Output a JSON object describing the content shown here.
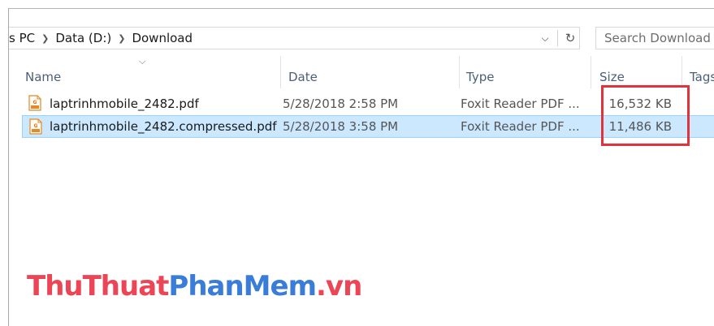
{
  "breadcrumb": {
    "items": [
      "s PC",
      "Data (D:)",
      "Download"
    ]
  },
  "search": {
    "placeholder": "Search Download"
  },
  "columns": {
    "name": "Name",
    "date": "Date",
    "type": "Type",
    "size": "Size",
    "tags": "Tags"
  },
  "files": [
    {
      "name": "laptrinhmobile_2482.pdf",
      "date": "5/28/2018 2:58 PM",
      "type": "Foxit Reader PDF ...",
      "size": "16,532 KB",
      "selected": false
    },
    {
      "name": "laptrinhmobile_2482.compressed.pdf",
      "date": "5/28/2018 3:58 PM",
      "type": "Foxit Reader PDF ...",
      "size": "11,486 KB",
      "selected": true
    }
  ],
  "watermark": {
    "part1": "ThuThuat",
    "part2": "PhanMem",
    "part3": ".vn"
  },
  "colors": {
    "selection_bg": "#cce8ff",
    "highlight_border": "#e0333c",
    "header_text": "#4c607a"
  }
}
